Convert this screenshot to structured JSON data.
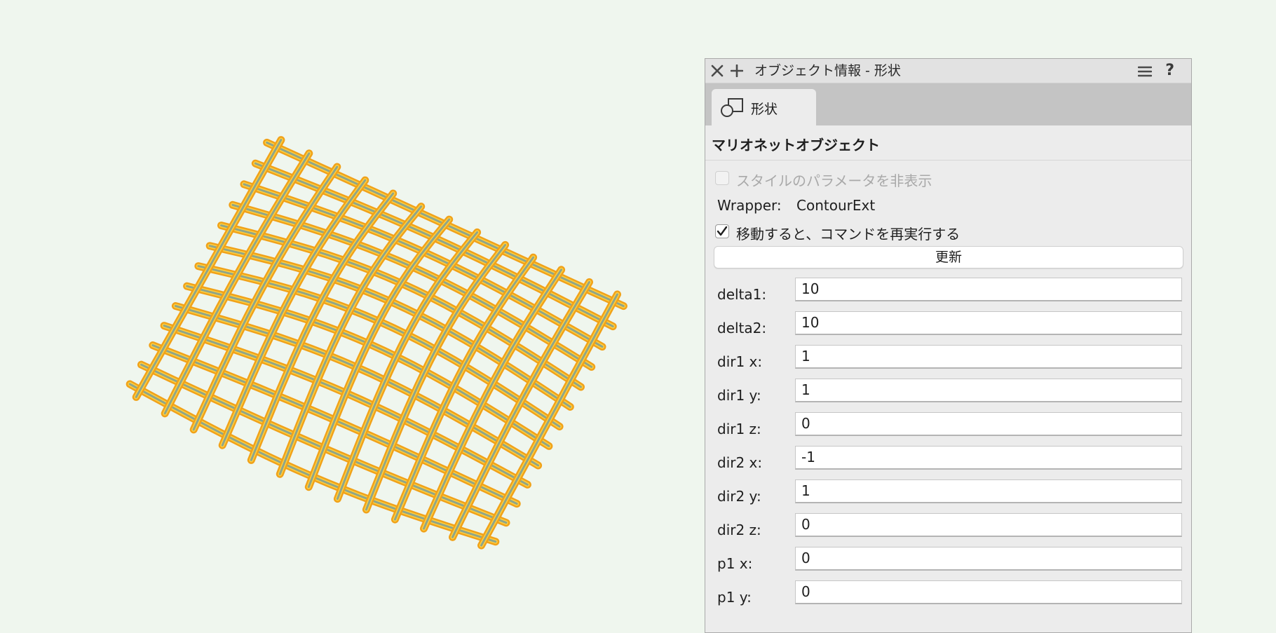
{
  "palette": {
    "title": "オブジェクト情報 - 形状",
    "help_glyph": "?",
    "tab": {
      "label": "形状"
    },
    "section_title": "マリオネットオブジェクト",
    "hide_style_params": {
      "label": "スタイルのパラメータを非表示",
      "checked": false,
      "enabled": false
    },
    "wrapper": {
      "label": "Wrapper:",
      "value": "ContourExt"
    },
    "rerun_on_move": {
      "label": "移動すると、コマンドを再実行する",
      "checked": true
    },
    "update_button": "更新",
    "fields": [
      {
        "label": "delta1:",
        "value": "10"
      },
      {
        "label": "delta2:",
        "value": "10"
      },
      {
        "label": "dir1 x:",
        "value": "1"
      },
      {
        "label": "dir1 y:",
        "value": "1"
      },
      {
        "label": "dir1 z:",
        "value": "0"
      },
      {
        "label": "dir2 x:",
        "value": "-1"
      },
      {
        "label": "dir2 y:",
        "value": "1"
      },
      {
        "label": "dir2 z:",
        "value": "0"
      },
      {
        "label": "p1 x:",
        "value": "0"
      },
      {
        "label": "p1 y:",
        "value": "0"
      }
    ]
  },
  "colors": {
    "background": "#eff6ee",
    "rod_outer": "#f0a21a",
    "rod_highlight": "#ffcf3f",
    "rod_core": "#8fa58a"
  }
}
